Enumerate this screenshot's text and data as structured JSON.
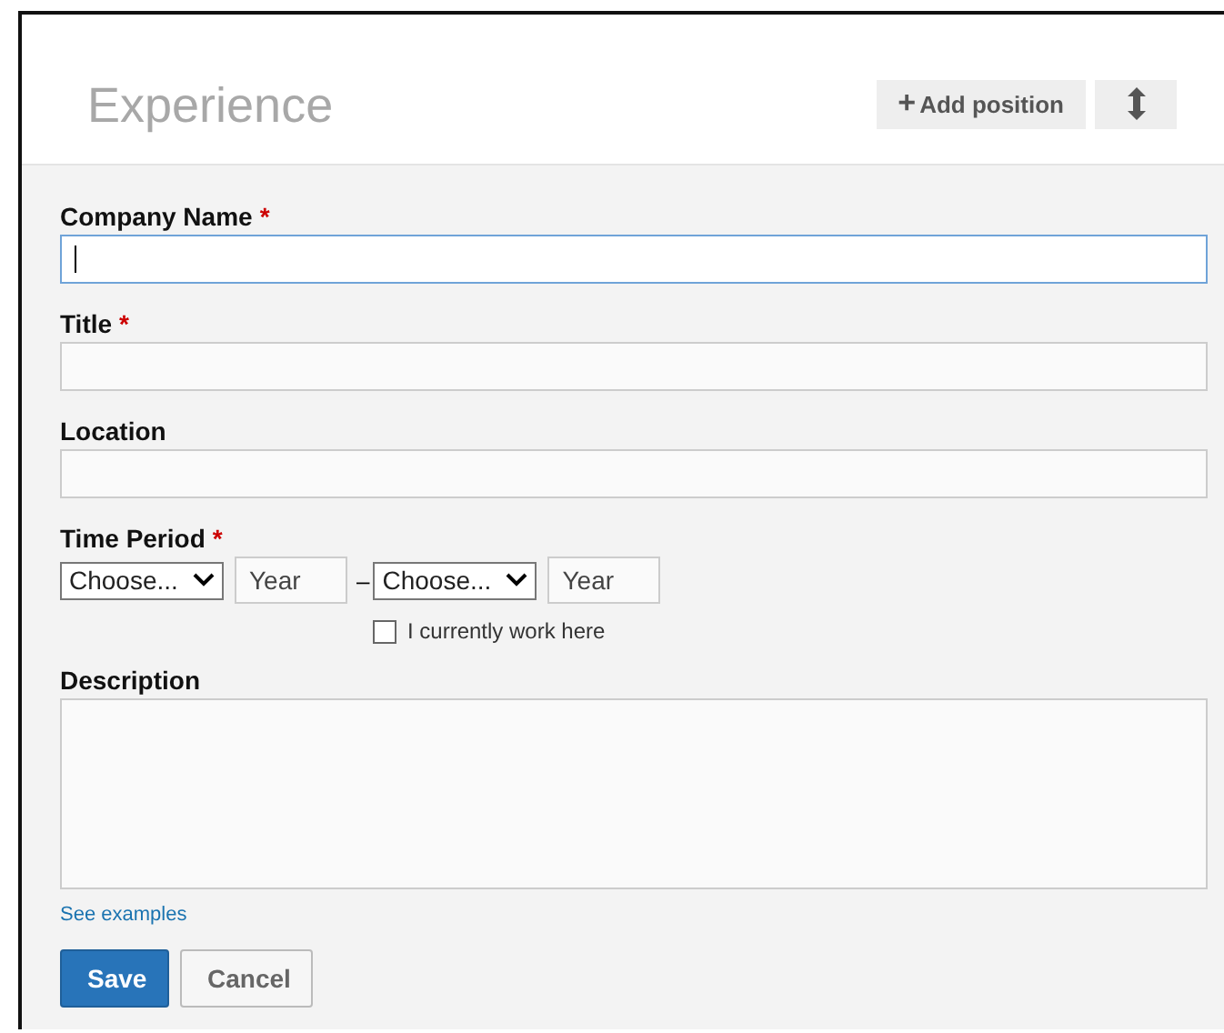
{
  "header": {
    "title": "Experience",
    "add_button": {
      "icon": "+",
      "label": "Add position"
    }
  },
  "fields": [
    {
      "kind": "text",
      "label": "Company Name",
      "required_mark": "*",
      "focused": true
    },
    {
      "kind": "text",
      "label": "Title",
      "required_mark": "*",
      "focused": false
    },
    {
      "kind": "text",
      "label": "Location",
      "focused": false
    },
    {
      "kind": "period",
      "label": "Time Period",
      "required_mark": "*",
      "start_month": "Choose...",
      "start_year_placeholder": "Year",
      "separator": "–",
      "end_month": "Choose...",
      "end_year_placeholder": "Year",
      "current": {
        "label": "I currently work here",
        "checked": false
      }
    },
    {
      "kind": "textarea",
      "label": "Description",
      "focused": false
    }
  ],
  "link": "See examples",
  "buttons": [
    {
      "kind": "primary",
      "label": "Save"
    },
    {
      "kind": "secondary",
      "label": "Cancel"
    }
  ]
}
